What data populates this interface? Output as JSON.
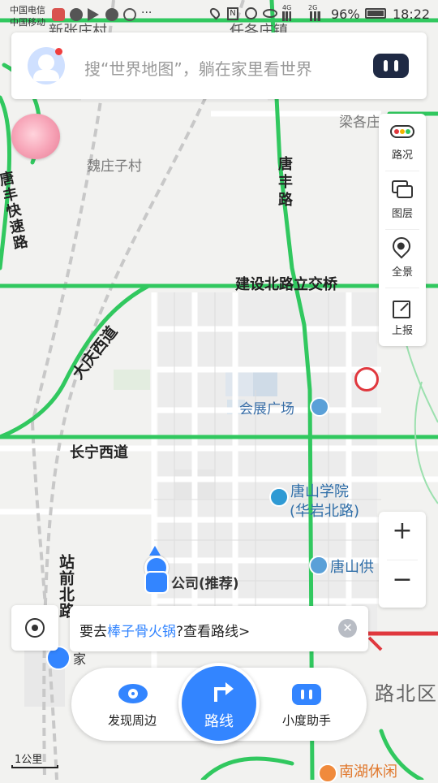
{
  "status_bar": {
    "carrier1": "中国电信",
    "carrier2": "中国移动",
    "network_small": "4G",
    "network_small2": "2G",
    "battery": "96%",
    "time": "18:22"
  },
  "search": {
    "placeholder": "搜“世界地图”，躺在家里看世界"
  },
  "side_tools": [
    {
      "label": "路况",
      "icon": "traffic-light-icon"
    },
    {
      "label": "图层",
      "icon": "layers-icon"
    },
    {
      "label": "全景",
      "icon": "panorama-pin-icon"
    },
    {
      "label": "上报",
      "icon": "report-edit-icon"
    }
  ],
  "zoom": {
    "in": "+",
    "out": "−"
  },
  "map_labels": {
    "xinzhangzhuang": "新张庄村",
    "rendezhuang": "任各庄镇",
    "lianggezhuang": "梁各庄",
    "weizhuangzi": "魏庄子村",
    "tangfeng_road": "唐丰路",
    "tangfeng_expressway": "唐丰快速路",
    "jianshe_bridge": "建设北路立交桥",
    "daqing_west": "大庆西道",
    "exhibition": "会展广场",
    "changning_west": "长宁西道",
    "tangshan_college_1": "唐山学院",
    "tangshan_college_2": "(华岩北路)",
    "company": "公司(推荐)",
    "tangshan_supply": "唐山供",
    "zhanqian_north": "站前北路",
    "home": "家",
    "lubei_district": "路北区",
    "nanhu_leisure": "南湖休闲"
  },
  "suggestion": {
    "prefix": "要去",
    "place": "棒子骨火锅",
    "suffix": "?查看路线>"
  },
  "bottom_bar": {
    "discover": "发现周边",
    "route": "路线",
    "assistant": "小度助手"
  },
  "scale": "1公里",
  "colors": {
    "accent": "#3385ff",
    "road_green": "#31c85f",
    "road_red": "#e0383e",
    "map_bg": "#f2f2f0"
  }
}
